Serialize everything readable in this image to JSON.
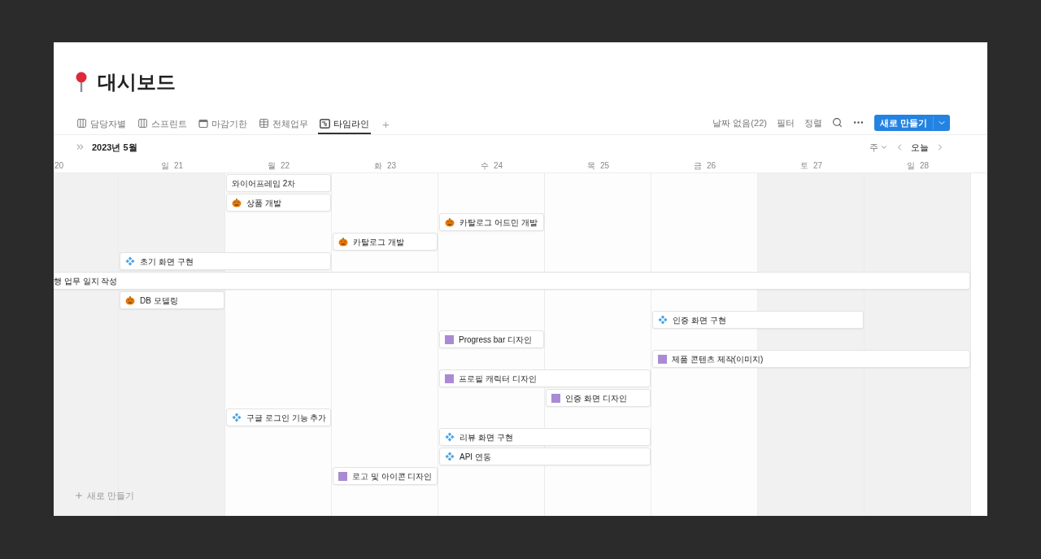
{
  "page": {
    "title": "대시보드"
  },
  "views": [
    {
      "label": "담당자별",
      "kind": "board",
      "selected": false
    },
    {
      "label": "스프린트",
      "kind": "board",
      "selected": false
    },
    {
      "label": "마감기한",
      "kind": "calendar",
      "selected": false
    },
    {
      "label": "전체업무",
      "kind": "table",
      "selected": false
    },
    {
      "label": "타임라인",
      "kind": "timeline",
      "selected": true
    }
  ],
  "add_view": "+",
  "toolbar": {
    "no_date": "날짜 없음(22)",
    "filter": "필터",
    "sort": "정렬",
    "new_button": "새로 만들기"
  },
  "timeline": {
    "month": "2023년 5월",
    "scale": "주",
    "today": "오늘",
    "days": [
      {
        "day": "20",
        "weekend": true
      },
      {
        "weekday": "일",
        "day": "21",
        "weekend": true
      },
      {
        "weekday": "월",
        "day": "22",
        "weekend": false
      },
      {
        "weekday": "화",
        "day": "23",
        "weekend": false
      },
      {
        "weekday": "수",
        "day": "24",
        "weekend": false
      },
      {
        "weekday": "목",
        "day": "25",
        "weekend": false
      },
      {
        "weekday": "금",
        "day": "26",
        "weekend": false
      },
      {
        "weekday": "토",
        "day": "27",
        "weekend": true
      },
      {
        "weekday": "일",
        "day": "28",
        "weekend": true
      }
    ],
    "items": [
      {
        "title": "와이어프레임 2차",
        "kind": "plain"
      },
      {
        "title": "상품 개발",
        "kind": "pumpkin"
      },
      {
        "title": "카탈로그 어드민 개발",
        "kind": "pumpkin"
      },
      {
        "title": "카탈로그 개발",
        "kind": "pumpkin"
      },
      {
        "title": "초기 화면 구현",
        "kind": "diamond"
      },
      {
        "title": "행 업무 일지 작성",
        "kind": "plain"
      },
      {
        "title": "DB 모델링",
        "kind": "pumpkin"
      },
      {
        "title": "인증 화면 구현",
        "kind": "diamond"
      },
      {
        "title": "Progress bar 디자인",
        "kind": "square"
      },
      {
        "title": "제품 콘텐츠 제작(이미지)",
        "kind": "square"
      },
      {
        "title": "프로필 캐릭터 디자인",
        "kind": "square"
      },
      {
        "title": "인증 화면 디자인",
        "kind": "square"
      },
      {
        "title": "구글 로그인 기능 추가",
        "kind": "diamond"
      },
      {
        "title": "리뷰 화면 구현",
        "kind": "diamond"
      },
      {
        "title": "API 연동",
        "kind": "diamond"
      },
      {
        "title": "로고 및 아이콘 디자인",
        "kind": "square"
      }
    ],
    "new_item": "새로 만들기"
  }
}
